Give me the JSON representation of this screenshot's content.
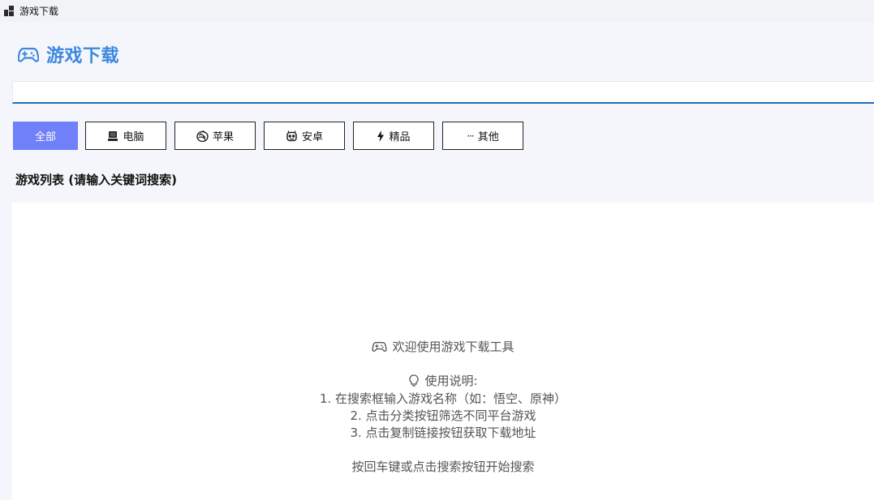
{
  "window": {
    "title": "游戏下载"
  },
  "header": {
    "title": "游戏下载",
    "icon": "gamepad-icon",
    "accent": "#3c88e0"
  },
  "search": {
    "value": "",
    "placeholder": ""
  },
  "filters": [
    {
      "label": "全部",
      "icon": "",
      "active": true
    },
    {
      "label": "电脑",
      "icon": "computer-icon",
      "active": false
    },
    {
      "label": "苹果",
      "icon": "apple-icon",
      "active": false
    },
    {
      "label": "安卓",
      "icon": "android-robot-icon",
      "active": false
    },
    {
      "label": "精品",
      "icon": "lightning-icon",
      "active": false
    },
    {
      "label": "其他",
      "icon": "ellipsis-icon",
      "active": false
    }
  ],
  "filter_active_color": "#6f80f8",
  "list": {
    "title": "游戏列表 (请输入关键词搜索)",
    "welcome": "欢迎使用游戏下载工具",
    "instructions_title": "使用说明:",
    "instructions": [
      "1. 在搜索框输入游戏名称（如：悟空、原神）",
      "2. 点击分类按钮筛选不同平台游戏",
      "3. 点击复制链接按钮获取下载地址"
    ],
    "hint": "按回车键或点击搜索按钮开始搜索"
  }
}
